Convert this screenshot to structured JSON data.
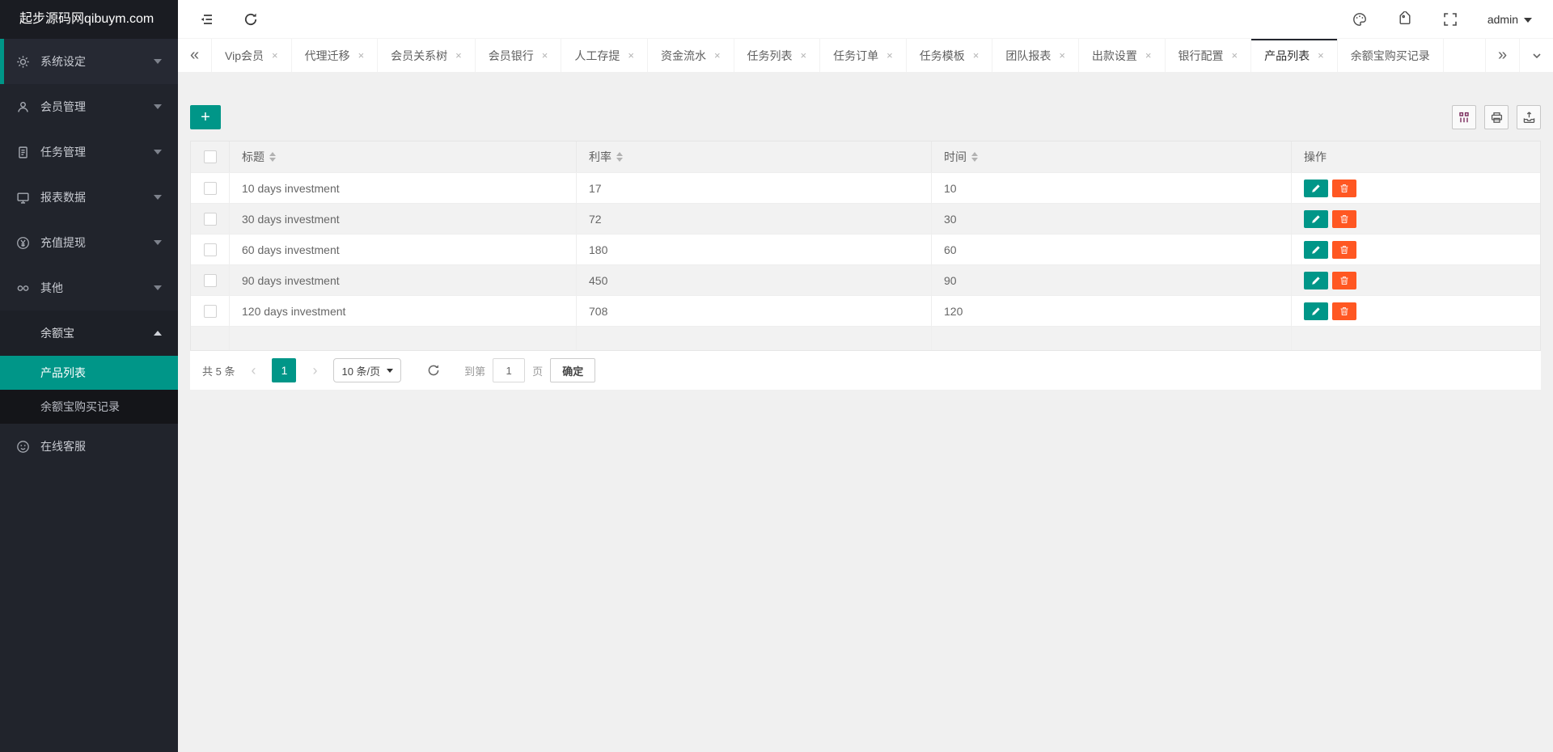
{
  "colors": {
    "accent": "#009688",
    "danger": "#FF5722",
    "sidebar_bg": "#21242C",
    "page_bg": "#F0F0F0",
    "header_bg": "#F2F2F2"
  },
  "sidebar": {
    "logo": "起步源码网qibuym.com",
    "items": [
      {
        "label": "系统设定"
      },
      {
        "label": "会员管理"
      },
      {
        "label": "任务管理"
      },
      {
        "label": "报表数据"
      },
      {
        "label": "充值提现"
      },
      {
        "label": "其他"
      }
    ],
    "group": {
      "label": "余额宝"
    },
    "group_items": [
      {
        "label": "产品列表",
        "active": true
      },
      {
        "label": "余额宝购买记录"
      }
    ],
    "footer_item": {
      "label": "在线客服"
    }
  },
  "topbar": {
    "user": "admin"
  },
  "tabbar": {
    "scroll_left": "«",
    "scroll_right": "»",
    "close_glyph": "×",
    "tabs": [
      {
        "label": "Vip会员"
      },
      {
        "label": "代理迁移"
      },
      {
        "label": "会员关系树"
      },
      {
        "label": "会员银行"
      },
      {
        "label": "人工存提"
      },
      {
        "label": "资金流水"
      },
      {
        "label": "任务列表"
      },
      {
        "label": "任务订单"
      },
      {
        "label": "任务模板"
      },
      {
        "label": "团队报表"
      },
      {
        "label": "出款设置"
      },
      {
        "label": "银行配置"
      },
      {
        "label": "产品列表",
        "active": true
      },
      {
        "label": "余额宝购买记录",
        "no_close": true
      }
    ]
  },
  "toolbar": {
    "add_label": "+"
  },
  "table": {
    "headers": {
      "title": "标题",
      "rate": "利率",
      "time": "时间",
      "actions": "操作"
    },
    "rows": [
      {
        "title": "10 days investment",
        "rate": "17",
        "time": "10"
      },
      {
        "title": "30 days investment",
        "rate": "72",
        "time": "30"
      },
      {
        "title": "60 days investment",
        "rate": "180",
        "time": "60"
      },
      {
        "title": "90 days investment",
        "rate": "450",
        "time": "90"
      },
      {
        "title": "120 days investment",
        "rate": "708",
        "time": "120"
      }
    ]
  },
  "pagination": {
    "total": "共 5 条",
    "prev": "‹",
    "current_page": "1",
    "next": "›",
    "page_size": "10 条/页",
    "goto_label": "到第",
    "goto_value": "1",
    "goto_unit": "页",
    "confirm_label": "确定"
  }
}
